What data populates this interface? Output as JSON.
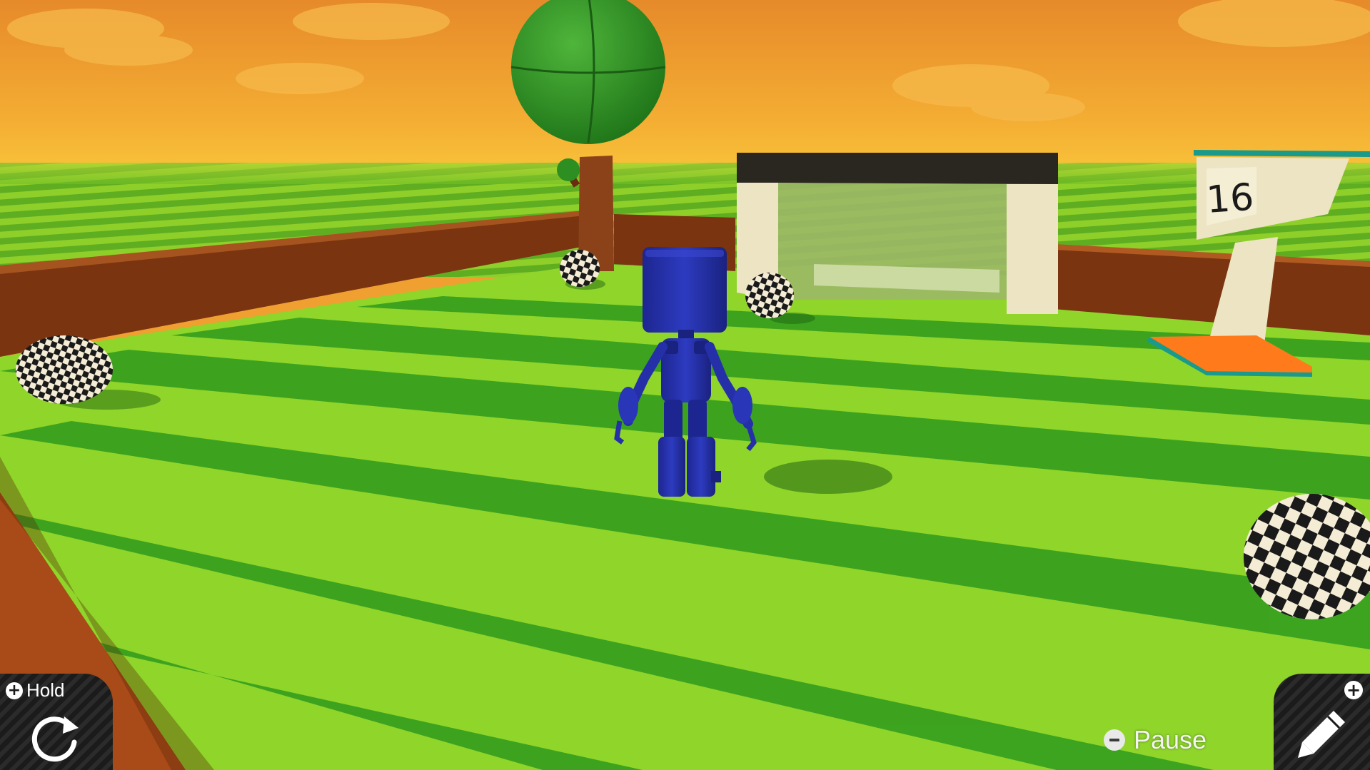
{
  "scene": {
    "sign": {
      "number": "16"
    },
    "colors": {
      "sky_top": "#e68a2a",
      "sky_bottom": "#f8c23a",
      "grass_light": "#8fd52a",
      "grass_dark": "#2f9b1e",
      "wall": "#8a3a14",
      "robot": "#2530a8",
      "tree_canopy": "#2d8e22",
      "tree_trunk": "#8b4218"
    }
  },
  "hud": {
    "hold": {
      "label": "Hold",
      "plus_glyph": "+",
      "icon": "rotate-icon"
    },
    "pause": {
      "label": "Pause",
      "icon": "minus-icon"
    },
    "edit": {
      "plus_glyph": "+",
      "icon": "pencil-icon"
    }
  }
}
